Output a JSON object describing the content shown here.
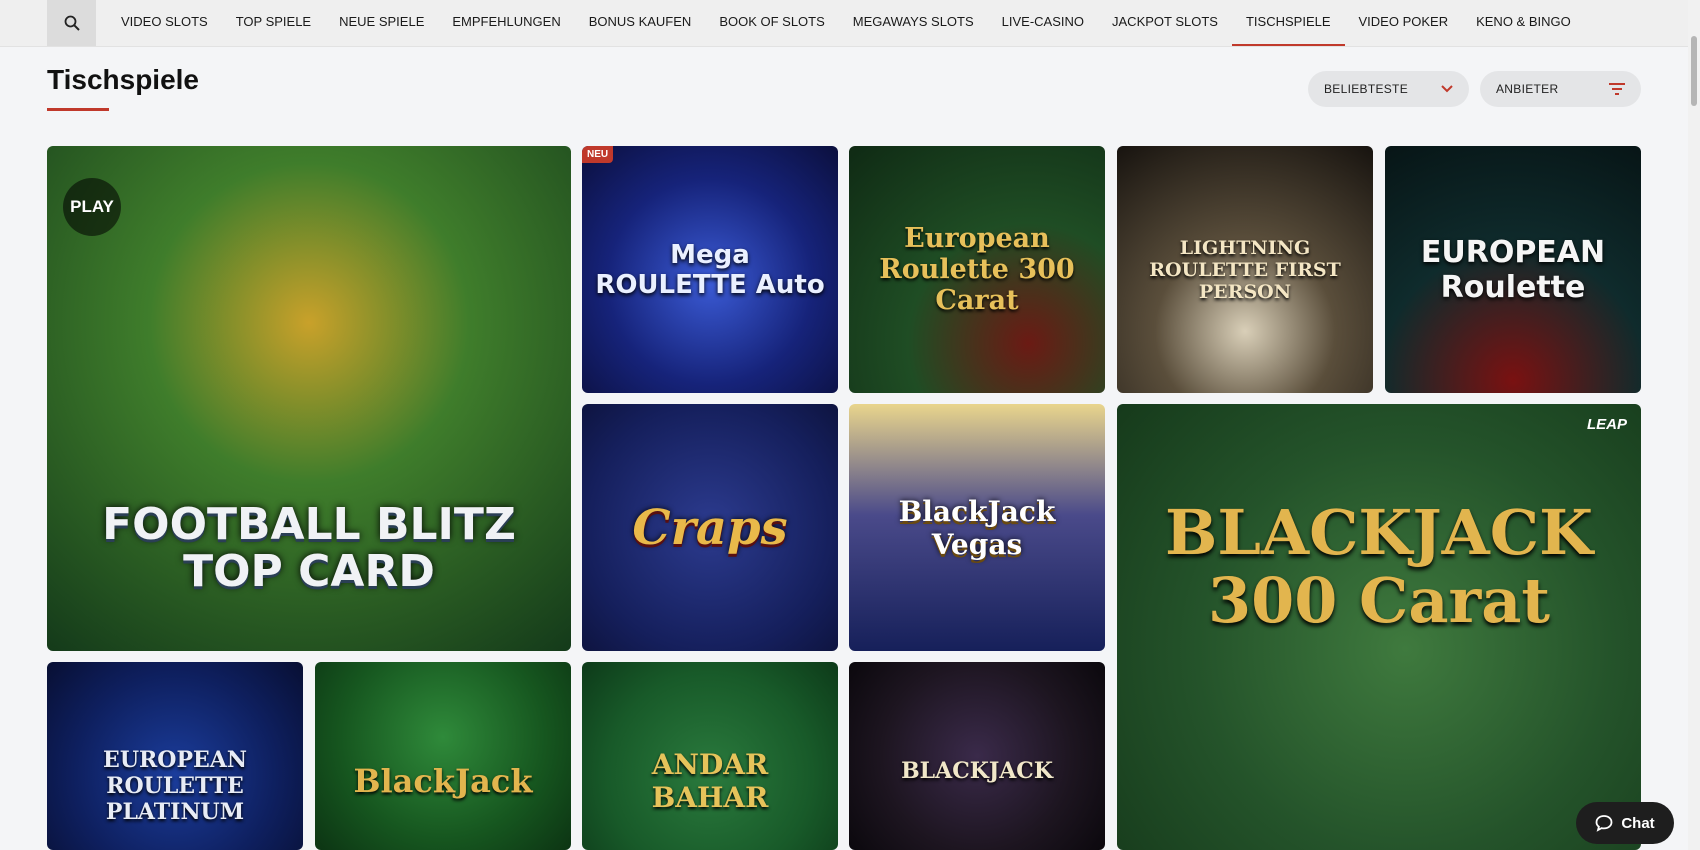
{
  "nav": {
    "items": [
      {
        "label": "VIDEO SLOTS"
      },
      {
        "label": "TOP SPIELE"
      },
      {
        "label": "NEUE SPIELE"
      },
      {
        "label": "EMPFEHLUNGEN"
      },
      {
        "label": "BONUS KAUFEN"
      },
      {
        "label": "BOOK OF SLOTS"
      },
      {
        "label": "MEGAWAYS SLOTS"
      },
      {
        "label": "LIVE-CASINO"
      },
      {
        "label": "JACKPOT SLOTS"
      },
      {
        "label": "TISCHSPIELE"
      },
      {
        "label": "VIDEO POKER"
      },
      {
        "label": "KENO & BINGO"
      }
    ],
    "active": "TISCHSPIELE"
  },
  "page": {
    "title": "Tischspiele"
  },
  "filters": {
    "sort_label": "BELIEBTESTE",
    "provider_label": "ANBIETER"
  },
  "colors": {
    "accent": "#c0392b",
    "chat_bg": "#1e1e1e"
  },
  "games": [
    {
      "title": "FOOTBALL BLITZ TOP CARD",
      "logo": "PLAY"
    },
    {
      "title": "Mega ROULETTE Auto",
      "badge": "NEU"
    },
    {
      "title": "European Roulette 300 Carat"
    },
    {
      "title": "LIGHTNING ROULETTE FIRST PERSON"
    },
    {
      "title": "EUROPEAN Roulette"
    },
    {
      "title": "Craps"
    },
    {
      "title": "BlackJack Vegas"
    },
    {
      "title": "BLACKJACK 300 Carat",
      "logo": "LEAP"
    },
    {
      "title": "EUROPEAN ROULETTE PLATINUM"
    },
    {
      "title": "BlackJack"
    },
    {
      "title": "ANDAR BAHAR"
    },
    {
      "title": "BLACKJACK"
    }
  ],
  "chat": {
    "label": "Chat",
    "icon": "chat-bubble-icon"
  }
}
